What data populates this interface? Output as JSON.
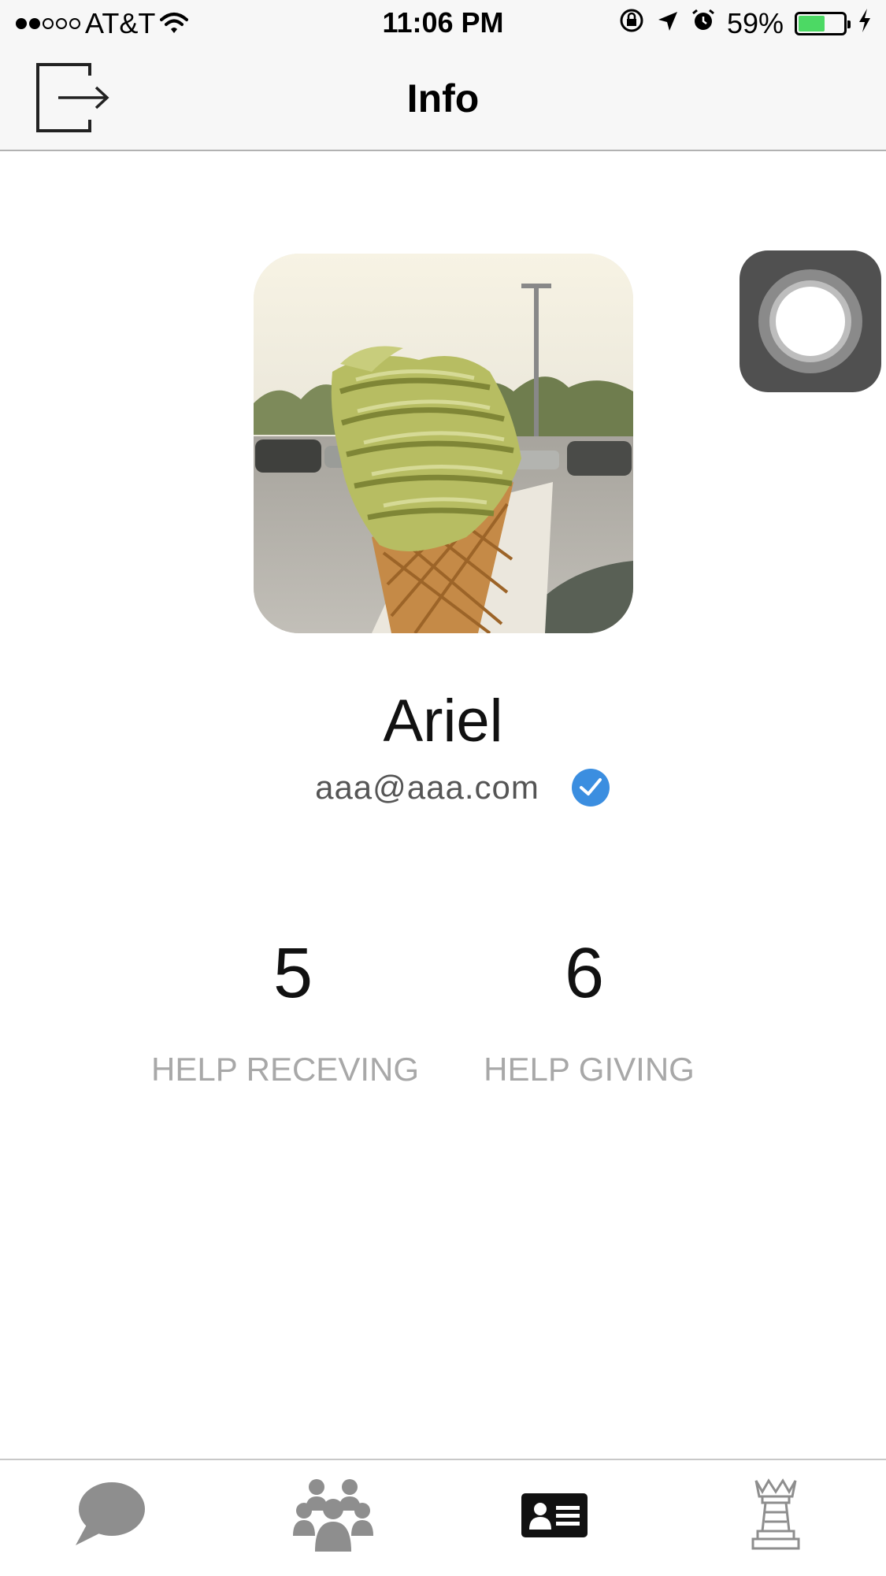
{
  "status_bar": {
    "carrier": "AT&T",
    "time": "11:06 PM",
    "battery_percent": "59%",
    "battery_level": 0.59,
    "signal_bars_filled": 2,
    "signal_bars_total": 5
  },
  "nav": {
    "title": "Info",
    "left_icon": "logout-icon"
  },
  "profile": {
    "name": "Ariel",
    "email": "aaa@aaa.com",
    "verified": true,
    "avatar_icon": "ice-cream-photo"
  },
  "stats": [
    {
      "value": "5",
      "label": "HELP RECEVING"
    },
    {
      "value": "6",
      "label": "HELP GIVING"
    }
  ],
  "tab_bar": {
    "tabs": [
      {
        "icon": "chat-bubble-icon",
        "selected": false
      },
      {
        "icon": "people-group-icon",
        "selected": false
      },
      {
        "icon": "id-card-icon",
        "selected": true
      },
      {
        "icon": "chess-king-icon",
        "selected": false
      }
    ]
  },
  "colors": {
    "verified_blue": "#3b8ee0",
    "battery_green": "#4cd964",
    "tab_inactive": "#8e8e8e",
    "tab_active": "#111111",
    "label_gray": "#a8a8a8"
  }
}
